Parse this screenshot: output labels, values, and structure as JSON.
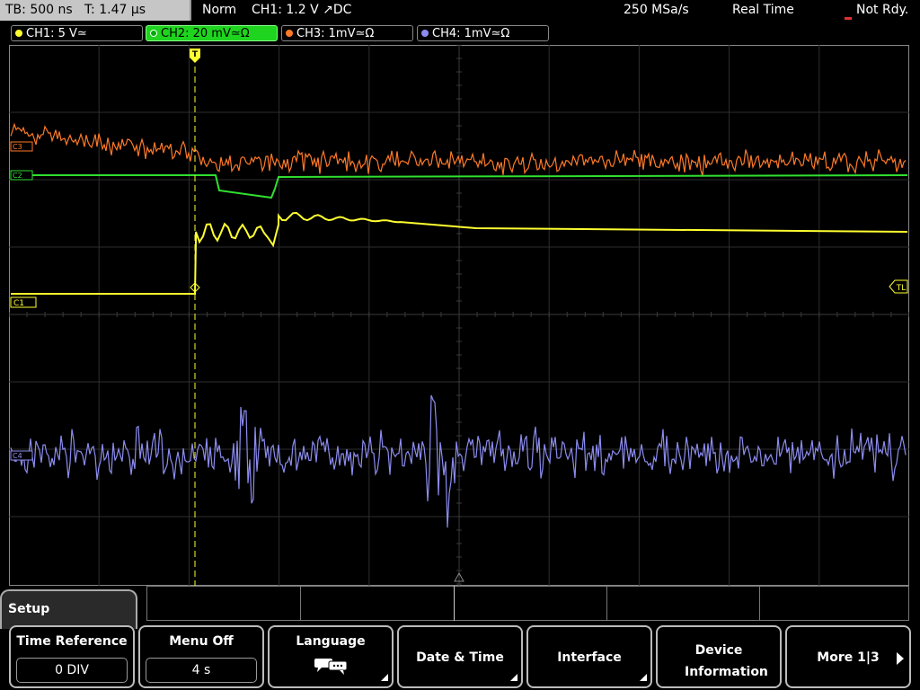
{
  "status": {
    "timebase": "TB: 500 ns",
    "trigger_time": "T: 1.47 µs",
    "mode": "Norm",
    "trigger_info": "CH1: 1.2 V ↗DC",
    "sample_rate": "250 MSa/s",
    "acq_mode": "Real Time",
    "state": "Not Rdy."
  },
  "channels": [
    {
      "label": "CH1: 5 V≃",
      "color": "#ffff30",
      "active": false
    },
    {
      "label": "CH2: 20 mV≃Ω",
      "color": "#30e030",
      "active": true
    },
    {
      "label": "CH3: 1mV≃Ω",
      "color": "#ff7a28",
      "active": false
    },
    {
      "label": "CH4: 1mV≃Ω",
      "color": "#8c8cf0",
      "active": false
    }
  ],
  "markers": {
    "trigger": "T",
    "trigger_level": "TL",
    "ch1": "C1",
    "ch2": "C2",
    "ch3": "C3",
    "ch4": "C4"
  },
  "menu": {
    "title": "Setup",
    "softkeys": [
      {
        "label": "Time Reference",
        "value": "0 DIV"
      },
      {
        "label": "Menu Off",
        "value": "4 s"
      },
      {
        "label": "Language",
        "icon": "speech-bubbles-icon"
      },
      {
        "label": "Date & Time"
      },
      {
        "label": "Interface"
      },
      {
        "label": "Device Information"
      },
      {
        "label": "More 1|3"
      }
    ]
  }
}
